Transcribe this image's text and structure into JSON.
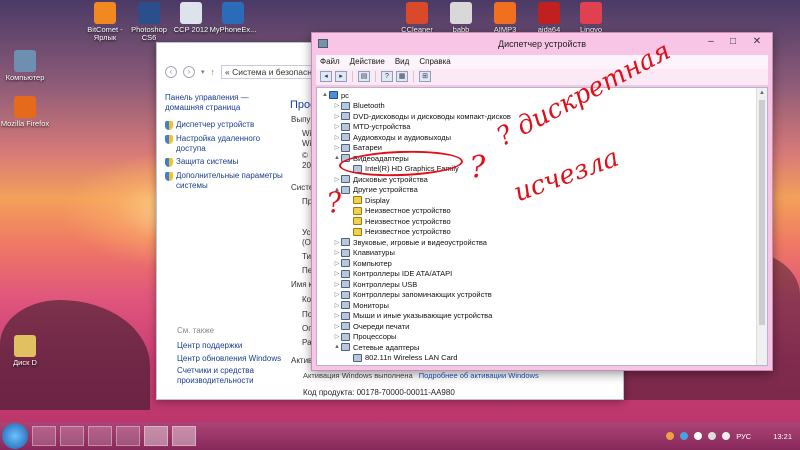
{
  "desktop": {
    "icons": [
      {
        "label": "BitComet - Ярлык",
        "color": "#f08a20"
      },
      {
        "label": "Photoshop CS6",
        "color": "#2a4f8a"
      },
      {
        "label": "CCP 2012",
        "color": "#dde3ea"
      },
      {
        "label": "MyPhoneEx...",
        "color": "#2b6cb8"
      },
      {
        "label": "CCleaner",
        "color": "#d84a2a"
      },
      {
        "label": "babb",
        "color": "#d8d8d8"
      },
      {
        "label": "AIMP3",
        "color": "#f07020"
      },
      {
        "label": "aida64",
        "color": "#c02020"
      },
      {
        "label": "Lingvo",
        "color": "#e04050"
      },
      {
        "label": "Компьютер",
        "color": "#6f8fb0"
      },
      {
        "label": "Mozilla Firefox",
        "color": "#e56a1c"
      },
      {
        "label": "Диск D",
        "color": "#e0c060"
      }
    ]
  },
  "control_panel": {
    "address": "« Система и безопасность",
    "home_link": "Панель управления — домашняя страница",
    "links": [
      "Диспетчер устройств",
      "Настройка удаленного доступа",
      "Защита системы",
      "Дополнительные параметры системы"
    ],
    "see_also": "См. также",
    "see_links": [
      "Центр поддержки",
      "Центр обновления Windows",
      "Счетчики и средства производительности"
    ],
    "right": {
      "title": "Прос",
      "t1": "Выпу",
      "t2": "Wi",
      "t3": "Wi",
      "t4": "©",
      "t5": "201",
      "sys": "Систе",
      "o1": "Пр",
      "o2": "Ус",
      "o3": "(ОЗ",
      "o4": "Ти",
      "o5": "Пе",
      "name": "Имя ко",
      "n1": "Ко",
      "n2": "По",
      "n3": "Оп",
      "n4": "Ра",
      "act": "Активи"
    },
    "activation": "Активация Windows выполнена",
    "activation_link": "Подробнее об активации Windows",
    "product_code": "Код продукта: 00178-70000-00011-AA980"
  },
  "device_manager": {
    "title": "Диспетчер устройств",
    "menu": [
      "Файл",
      "Действие",
      "Вид",
      "Справка"
    ],
    "tree": [
      {
        "text": "pc",
        "level": 0,
        "exp": "▲",
        "icon": "pc"
      },
      {
        "text": "Bluetooth",
        "level": 1,
        "exp": "▷",
        "icon": ""
      },
      {
        "text": "DVD-дисководы и дисководы компакт-дисков",
        "level": 1,
        "exp": "▷",
        "icon": ""
      },
      {
        "text": "MTD-устройства",
        "level": 1,
        "exp": "▷",
        "icon": ""
      },
      {
        "text": "Аудиовходы и аудиовыходы",
        "level": 1,
        "exp": "▷",
        "icon": ""
      },
      {
        "text": "Батареи",
        "level": 1,
        "exp": "▷",
        "icon": ""
      },
      {
        "text": "Видеоадаптеры",
        "level": 1,
        "exp": "▲",
        "icon": ""
      },
      {
        "text": "Intel(R) HD Graphics Family",
        "level": 2,
        "exp": "",
        "icon": ""
      },
      {
        "text": "Дисковые устройства",
        "level": 1,
        "exp": "▷",
        "icon": ""
      },
      {
        "text": "Другие устройства",
        "level": 1,
        "exp": "▲",
        "icon": ""
      },
      {
        "text": "Display",
        "level": 2,
        "exp": "",
        "icon": "warn"
      },
      {
        "text": "Неизвестное устройство",
        "level": 2,
        "exp": "",
        "icon": "warn"
      },
      {
        "text": "Неизвестное устройство",
        "level": 2,
        "exp": "",
        "icon": "warn"
      },
      {
        "text": "Неизвестное устройство",
        "level": 2,
        "exp": "",
        "icon": "warn"
      },
      {
        "text": "Звуковые, игровые и видеоустройства",
        "level": 1,
        "exp": "▷",
        "icon": ""
      },
      {
        "text": "Клавиатуры",
        "level": 1,
        "exp": "▷",
        "icon": ""
      },
      {
        "text": "Компьютер",
        "level": 1,
        "exp": "▷",
        "icon": ""
      },
      {
        "text": "Контроллеры IDE ATA/ATAPI",
        "level": 1,
        "exp": "▷",
        "icon": ""
      },
      {
        "text": "Контроллеры USB",
        "level": 1,
        "exp": "▷",
        "icon": ""
      },
      {
        "text": "Контроллеры запоминающих устройств",
        "level": 1,
        "exp": "▷",
        "icon": ""
      },
      {
        "text": "Мониторы",
        "level": 1,
        "exp": "▷",
        "icon": ""
      },
      {
        "text": "Мыши и иные указывающие устройства",
        "level": 1,
        "exp": "▷",
        "icon": ""
      },
      {
        "text": "Очереди печати",
        "level": 1,
        "exp": "▷",
        "icon": ""
      },
      {
        "text": "Процессоры",
        "level": 1,
        "exp": "▷",
        "icon": ""
      },
      {
        "text": "Сетевые адаптеры",
        "level": 1,
        "exp": "▲",
        "icon": ""
      },
      {
        "text": "802.11n Wireless LAN Card",
        "level": 2,
        "exp": "",
        "icon": ""
      }
    ]
  },
  "annotation": {
    "line1": "? дискретная",
    "line2": "исчезла",
    "q1": "?",
    "q2": "?",
    "color": "#e0101a"
  },
  "taskbar": {
    "lang": "РУС",
    "time": "13:21"
  }
}
